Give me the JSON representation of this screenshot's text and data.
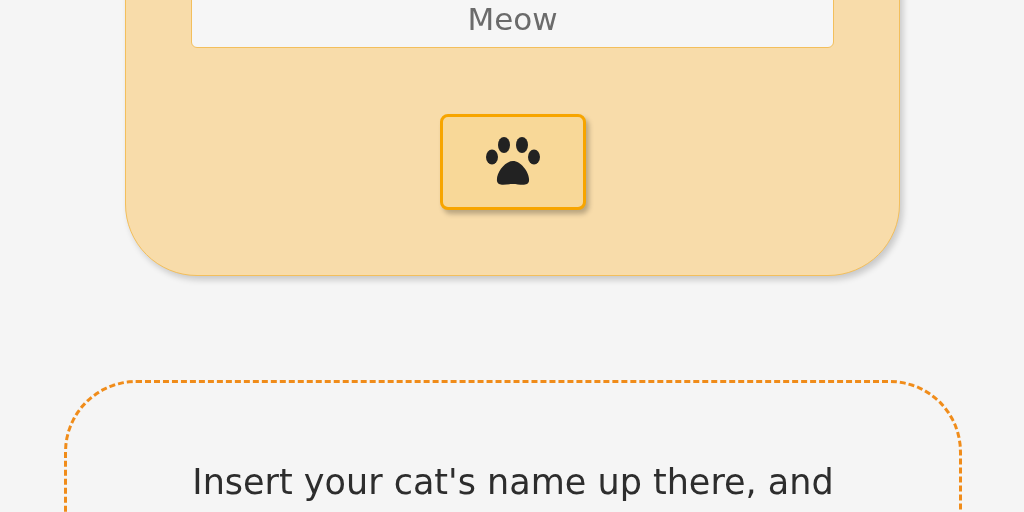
{
  "name_form": {
    "name_field": {
      "placeholder": "Meow"
    }
  },
  "hint": {
    "text": "Insert your cat's name up there, and"
  }
}
